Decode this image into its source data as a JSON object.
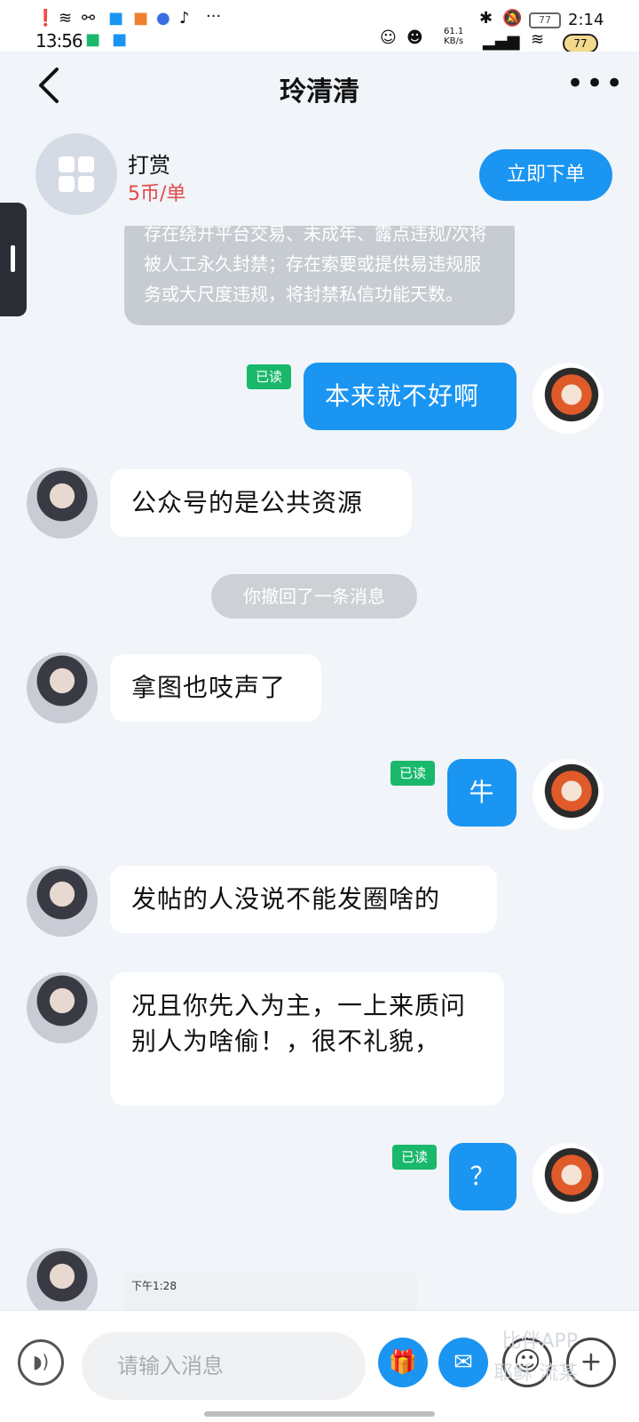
{
  "status_bar": {
    "time": "13:56",
    "time_secondary": "2:14",
    "net_speed_value": "61.1",
    "net_speed_unit": "KB/s",
    "battery_level": "77",
    "battery_badge": "77",
    "overflow": "···"
  },
  "nav": {
    "title": "玲清清"
  },
  "order_card": {
    "service_title": "打赏",
    "price": "5币/单",
    "order_button": "立即下单"
  },
  "notice": {
    "text": "存在绕开平台交易、未成年、露点违规/次将被人工永久封禁；存在索要或提供易违规服务或大尺度违规，将封禁私信功能天数。"
  },
  "read_label": "已读",
  "messages": [
    {
      "direction": "out",
      "text": "本来就不好啊",
      "status": "已读"
    },
    {
      "direction": "in",
      "text": "公众号的是公共资源"
    },
    {
      "direction": "system",
      "text": "你撤回了一条消息"
    },
    {
      "direction": "in",
      "text": "拿图也吱声了"
    },
    {
      "direction": "out",
      "text": "牛",
      "status": "已读"
    },
    {
      "direction": "in",
      "text": "发帖的人没说不能发圈啥的"
    },
    {
      "direction": "in",
      "text": "况且你先入为主，一上来质问别人为啥偷！，很不礼貌，"
    },
    {
      "direction": "out",
      "text": "？",
      "status": "已读"
    }
  ],
  "partial_image_caption": "下午1:28",
  "input_bar": {
    "placeholder": "请输入消息"
  },
  "watermark": {
    "line1": "比伴APP",
    "line2": "耶稣 流某"
  },
  "colors": {
    "accent": "#1b95f2",
    "read_badge": "#19b86b",
    "price": "#e24a4a",
    "background": "#f1f4f8"
  }
}
